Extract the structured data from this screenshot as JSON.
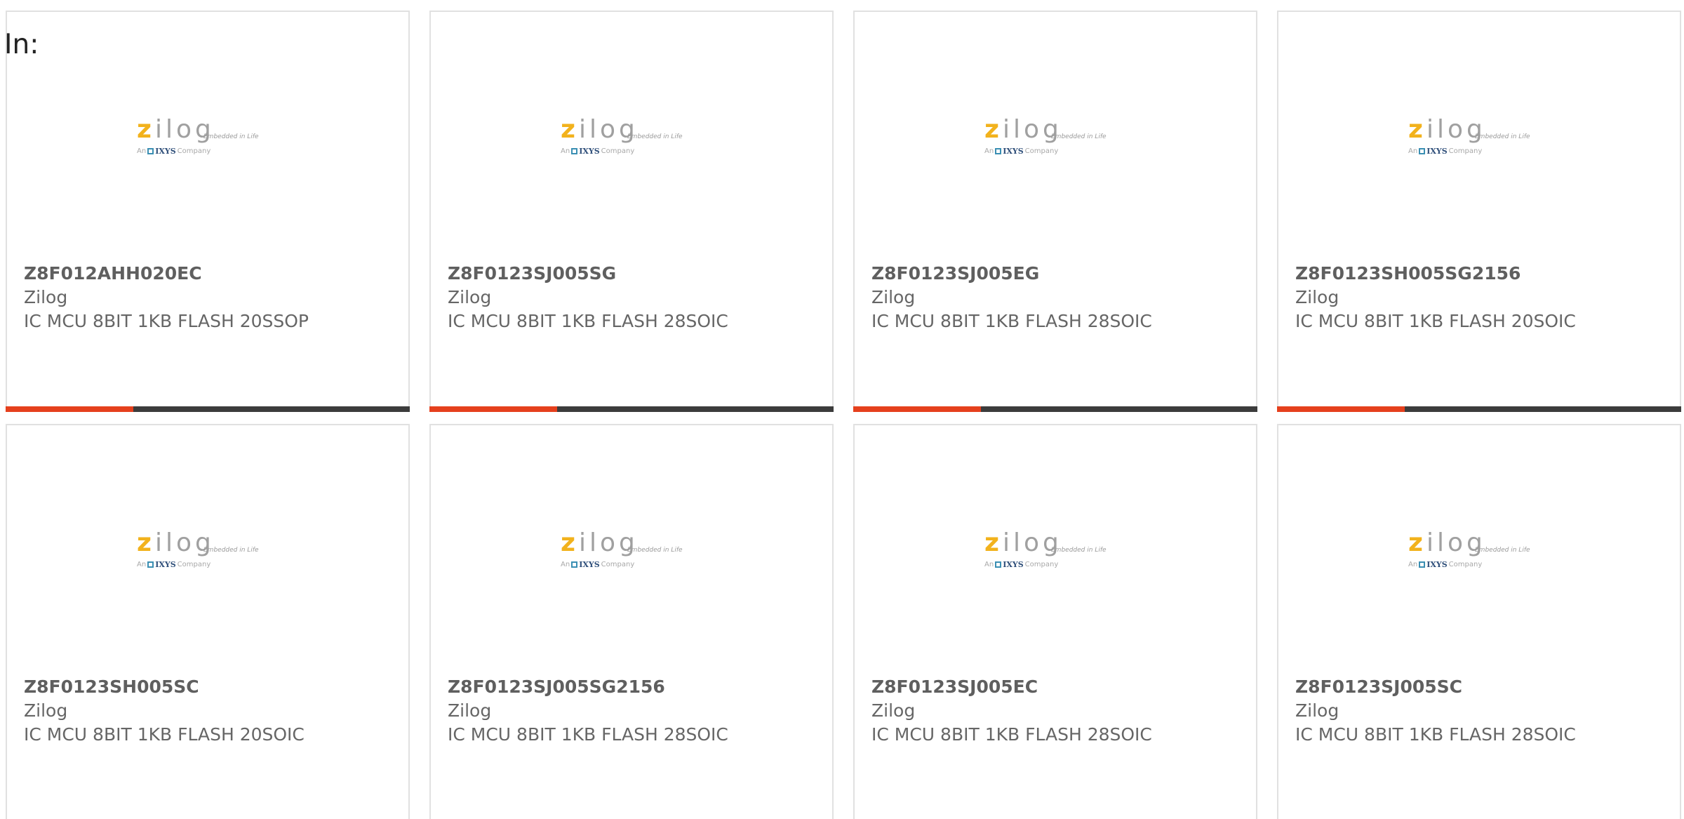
{
  "filter": {
    "label": "In:"
  },
  "logo": {
    "word": "zilog",
    "z_letter": "z",
    "rest_letters": "ilog",
    "tagline": "Embedded in Life",
    "sub_prefix": "An",
    "sub_brand": "IXYS",
    "sub_suffix": "Company"
  },
  "colors": {
    "accent": "#e5401d",
    "bar": "#3c3c3c",
    "logo_z": "#f2b21c",
    "border": "#e1e1e1"
  },
  "products": [
    {
      "part": "Z8F012AHH020EC",
      "maker": "Zilog",
      "desc": "IC MCU 8BIT 1KB FLASH 20SSOP"
    },
    {
      "part": "Z8F0123SJ005SG",
      "maker": "Zilog",
      "desc": "IC MCU 8BIT 1KB FLASH 28SOIC"
    },
    {
      "part": "Z8F0123SJ005EG",
      "maker": "Zilog",
      "desc": "IC MCU 8BIT 1KB FLASH 28SOIC"
    },
    {
      "part": "Z8F0123SH005SG2156",
      "maker": "Zilog",
      "desc": "IC MCU 8BIT 1KB FLASH 20SOIC"
    },
    {
      "part": "Z8F0123SH005SC",
      "maker": "Zilog",
      "desc": "IC MCU 8BIT 1KB FLASH 20SOIC"
    },
    {
      "part": "Z8F0123SJ005SG2156",
      "maker": "Zilog",
      "desc": "IC MCU 8BIT 1KB FLASH 28SOIC"
    },
    {
      "part": "Z8F0123SJ005EC",
      "maker": "Zilog",
      "desc": "IC MCU 8BIT 1KB FLASH 28SOIC"
    },
    {
      "part": "Z8F0123SJ005SC",
      "maker": "Zilog",
      "desc": "IC MCU 8BIT 1KB FLASH 28SOIC"
    }
  ]
}
